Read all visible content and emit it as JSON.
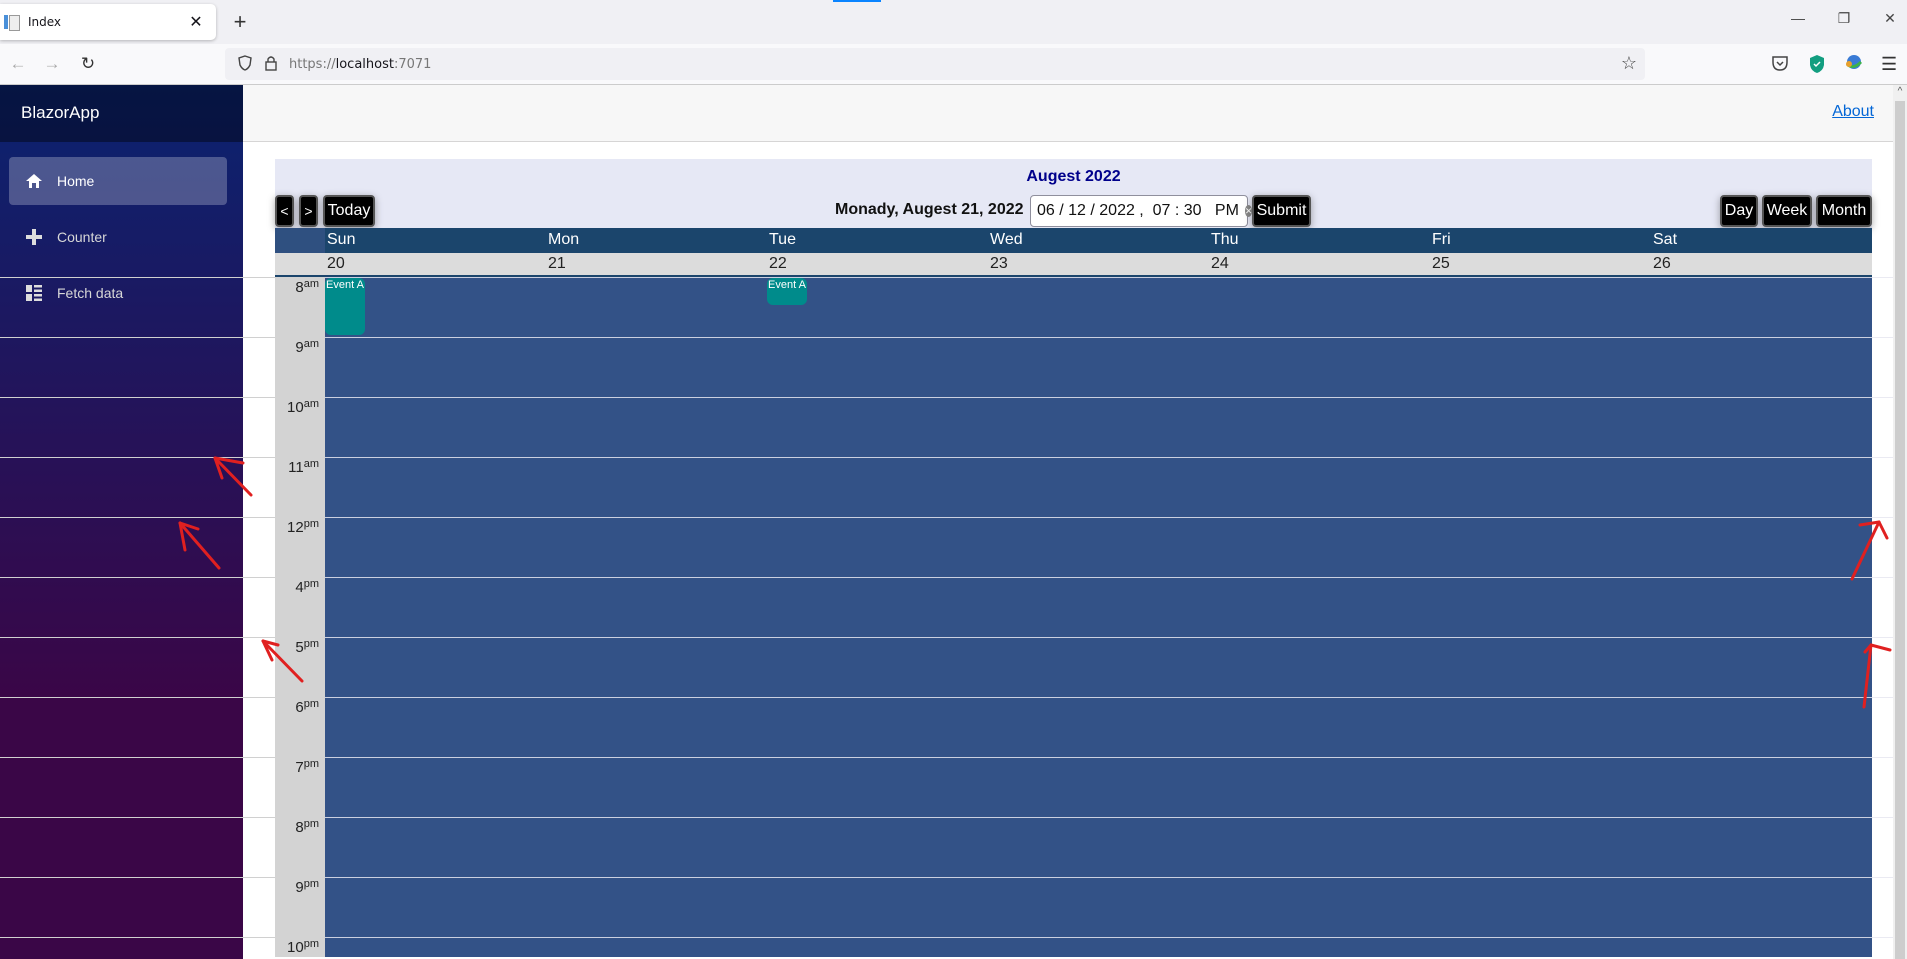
{
  "browser": {
    "tab_title": "Index",
    "url_scheme": "https://",
    "url_host": "localhost",
    "url_port": ":7071"
  },
  "sidebar": {
    "brand": "BlazorApp",
    "items": [
      {
        "label": "Home",
        "icon": "home-icon",
        "active": true
      },
      {
        "label": "Counter",
        "icon": "plus-icon",
        "active": false
      },
      {
        "label": "Fetch data",
        "icon": "list-icon",
        "active": false
      }
    ]
  },
  "topbar": {
    "about_label": "About"
  },
  "calendar": {
    "title": "Augest 2022",
    "prev_label": "<",
    "next_label": ">",
    "today_label": "Today",
    "current_date_label": "Monady, Augest 21, 2022",
    "datetime_input": "06 / 12 / 2022 ,  07 : 30   PM",
    "submit_label": "Submit",
    "view_buttons": [
      "Day",
      "Week",
      "Month"
    ],
    "days": [
      {
        "name": "Sun",
        "date": "20"
      },
      {
        "name": "Mon",
        "date": "21"
      },
      {
        "name": "Tue",
        "date": "22"
      },
      {
        "name": "Wed",
        "date": "23"
      },
      {
        "name": "Thu",
        "date": "24"
      },
      {
        "name": "Fri",
        "date": "25"
      },
      {
        "name": "Sat",
        "date": "26"
      }
    ],
    "hours": [
      {
        "num": "8",
        "suffix": "am"
      },
      {
        "num": "9",
        "suffix": "am"
      },
      {
        "num": "10",
        "suffix": "am"
      },
      {
        "num": "11",
        "suffix": "am"
      },
      {
        "num": "12",
        "suffix": "pm"
      },
      {
        "num": "4",
        "suffix": "pm"
      },
      {
        "num": "5",
        "suffix": "pm"
      },
      {
        "num": "6",
        "suffix": "pm"
      },
      {
        "num": "7",
        "suffix": "pm"
      },
      {
        "num": "8",
        "suffix": "pm"
      },
      {
        "num": "9",
        "suffix": "pm"
      },
      {
        "num": "10",
        "suffix": "pm"
      }
    ],
    "events": [
      {
        "title": "Event A",
        "day": "Sun",
        "hour_row": 0,
        "span_rows": 1.0
      },
      {
        "title": "Event A",
        "day": "Tue",
        "hour_row": 0,
        "span_rows": 0.5
      }
    ]
  },
  "colors": {
    "event": "#008b8b",
    "day_header": "#1b456c",
    "grid": "#335287",
    "title": "#00008b",
    "annotation": "#e02020"
  }
}
